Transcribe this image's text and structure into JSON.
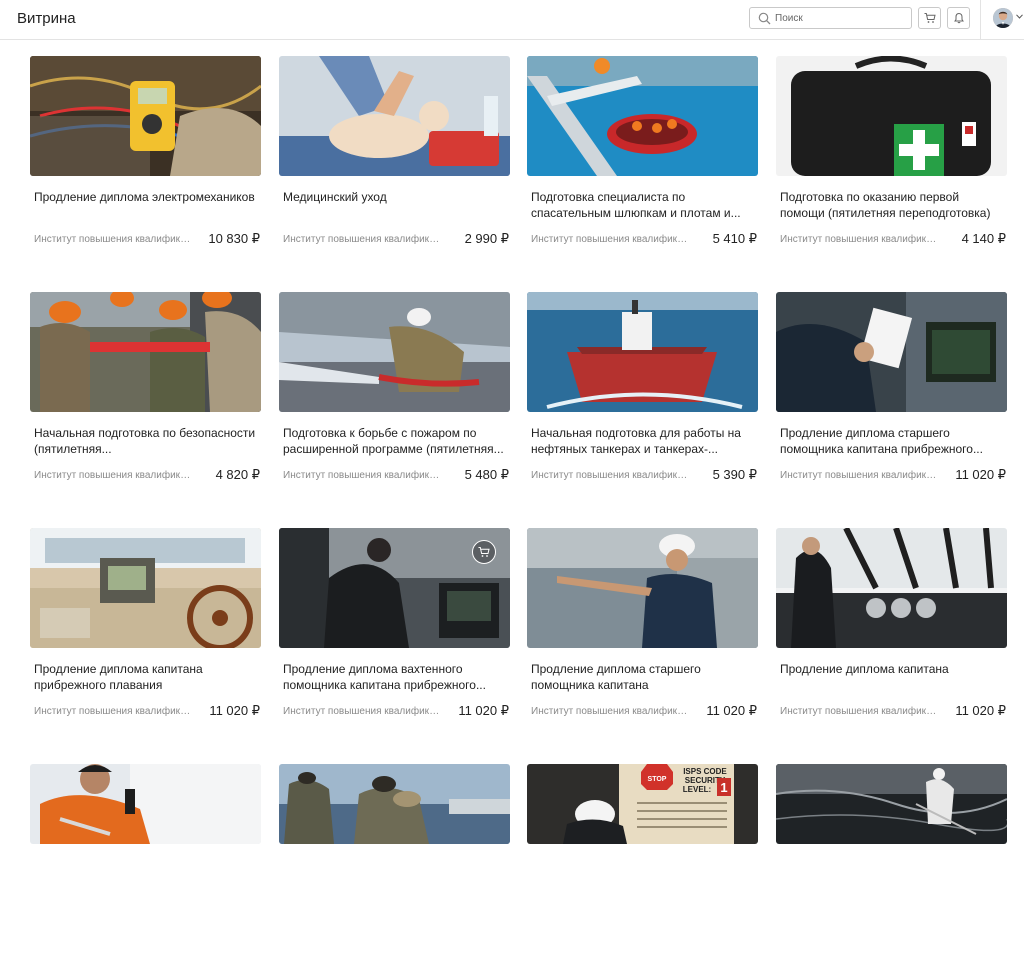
{
  "header": {
    "title": "Витрина",
    "search_placeholder": "Поиск",
    "icons": [
      "search-icon",
      "cart-icon",
      "bell-icon",
      "user-avatar",
      "chevron-down-icon"
    ]
  },
  "products": [
    {
      "title": "Продление диплома электромехаников",
      "vendor": "Институт повышения квалификац...",
      "price": "10 830 ₽",
      "image": "electrician-multimeter"
    },
    {
      "title": "Медицинский уход",
      "vendor": "Институт повышения квалификац...",
      "price": "2 990 ₽",
      "image": "cpr-training"
    },
    {
      "title": "Подготовка специалиста по спасательным шлюпкам и плотам и...",
      "vendor": "Институт повышения квалификац...",
      "price": "5 410 ₽",
      "image": "life-raft-pool"
    },
    {
      "title": "Подготовка по оказанию первой помощи (пятилетняя переподготовка)",
      "vendor": "Институт повышения квалификац...",
      "price": "4 140 ₽",
      "image": "first-aid-bag"
    },
    {
      "title": "Начальная подготовка по безопасности (пятилетняя...",
      "vendor": "Институт повышения квалификац...",
      "price": "4 820 ₽",
      "image": "crew-hardhats"
    },
    {
      "title": "Подготовка к борьбе с пожаром по расширенной программе (пятилетняя...",
      "vendor": "Институт повышения квалификац...",
      "price": "5 480 ₽",
      "image": "firefighter-hose"
    },
    {
      "title": "Начальная подготовка для работы на нефтяных танкерах и танкерах-...",
      "vendor": "Институт повышения квалификац...",
      "price": "5 390 ₽",
      "image": "oil-tanker"
    },
    {
      "title": "Продление диплома старшего помощника капитана прибрежного...",
      "vendor": "Институт повышения квалификац...",
      "price": "11 020 ₽",
      "image": "officer-clipboard"
    },
    {
      "title": "Продление диплома капитана прибрежного плавания",
      "vendor": "Институт повышения квалификац...",
      "price": "11 020 ₽",
      "image": "ship-wheel"
    },
    {
      "title": "Продление диплома вахтенного помощника капитана прибрежного...",
      "vendor": "Институт повышения квалификац...",
      "price": "11 020 ₽",
      "image": "bridge-radio",
      "show_cart": true
    },
    {
      "title": "Продление диплома старшего помощника капитана",
      "vendor": "Институт повышения квалификац...",
      "price": "11 020 ₽",
      "image": "engineer-pointing"
    },
    {
      "title": "Продление диплома капитана",
      "vendor": "Институт повышения квалификац...",
      "price": "11 020 ₽",
      "image": "bridge-console"
    },
    {
      "title": "",
      "vendor": "",
      "price": "",
      "image": "orange-coverall-radio"
    },
    {
      "title": "",
      "vendor": "",
      "price": "",
      "image": "armed-guards"
    },
    {
      "title": "",
      "vendor": "",
      "price": "",
      "image": "isps-code-sign",
      "sign_lines": [
        "STOP",
        "ISPS CODE",
        "SECURITY",
        "LEVEL:",
        "1"
      ]
    },
    {
      "title": "",
      "vendor": "",
      "price": "",
      "image": "oil-spill-cleanup"
    }
  ]
}
